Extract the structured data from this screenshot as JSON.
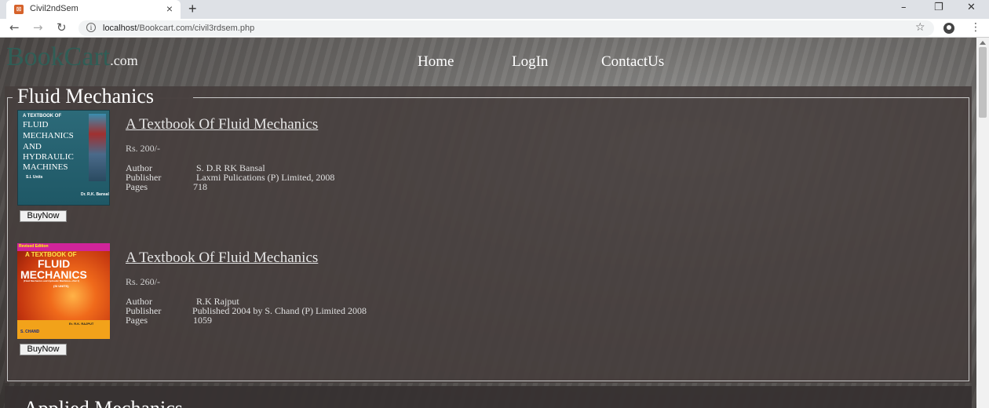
{
  "browser": {
    "tab_title": "Civil2ndSem",
    "tab_close": "×",
    "new_tab": "+",
    "url_host": "localhost",
    "url_path": "/Bookcart.com/civil3rdsem.php",
    "window_controls": [
      "–",
      "❐",
      "✕"
    ]
  },
  "site": {
    "logo_main": "BookCart",
    "logo_suffix": ".com",
    "nav": [
      "Home",
      "LogIn",
      "ContactUs"
    ]
  },
  "section": {
    "title": "Fluid Mechanics",
    "next_title": "Applied Mechanics"
  },
  "books": [
    {
      "title": "A Textbook Of Fluid Mechanics ",
      "price": "Rs. 200/-",
      "author_label": "Author",
      "author": "S. D.R RK Bansal",
      "publisher_label": "Publisher",
      "publisher": "Laxmi Pulications (P) Limited, 2008",
      "pages_label": "Pages",
      "pages": "718",
      "buy_label": "BuyNow",
      "cover_lines": [
        "A TEXTBOOK OF",
        "FLUID",
        "MECHANICS",
        "AND",
        "HYDRAULIC",
        "MACHINES",
        "S.I. Units",
        "Dr. R.K. Bansal"
      ]
    },
    {
      "title": "A Textbook Of Fluid Mechanics",
      "price": "Rs. 260/-",
      "author_label": "Author",
      "author": "R.K Rajput",
      "publisher_label": "Publisher",
      "publisher": "Published 2004 by S. Chand (P) Limited 2008",
      "pages_label": "Pages",
      "pages": "1059",
      "buy_label": "BuyNow",
      "cover_lines": [
        "Revised Edition",
        "A TEXTBOOK OF",
        "FLUID",
        "MECHANICS",
        "(Fluid Mechanics and Hydraulic Machines—Part I)",
        "(SI UNITS)",
        "S. CHAND",
        "Er. R.K. RAJPUT"
      ]
    }
  ]
}
